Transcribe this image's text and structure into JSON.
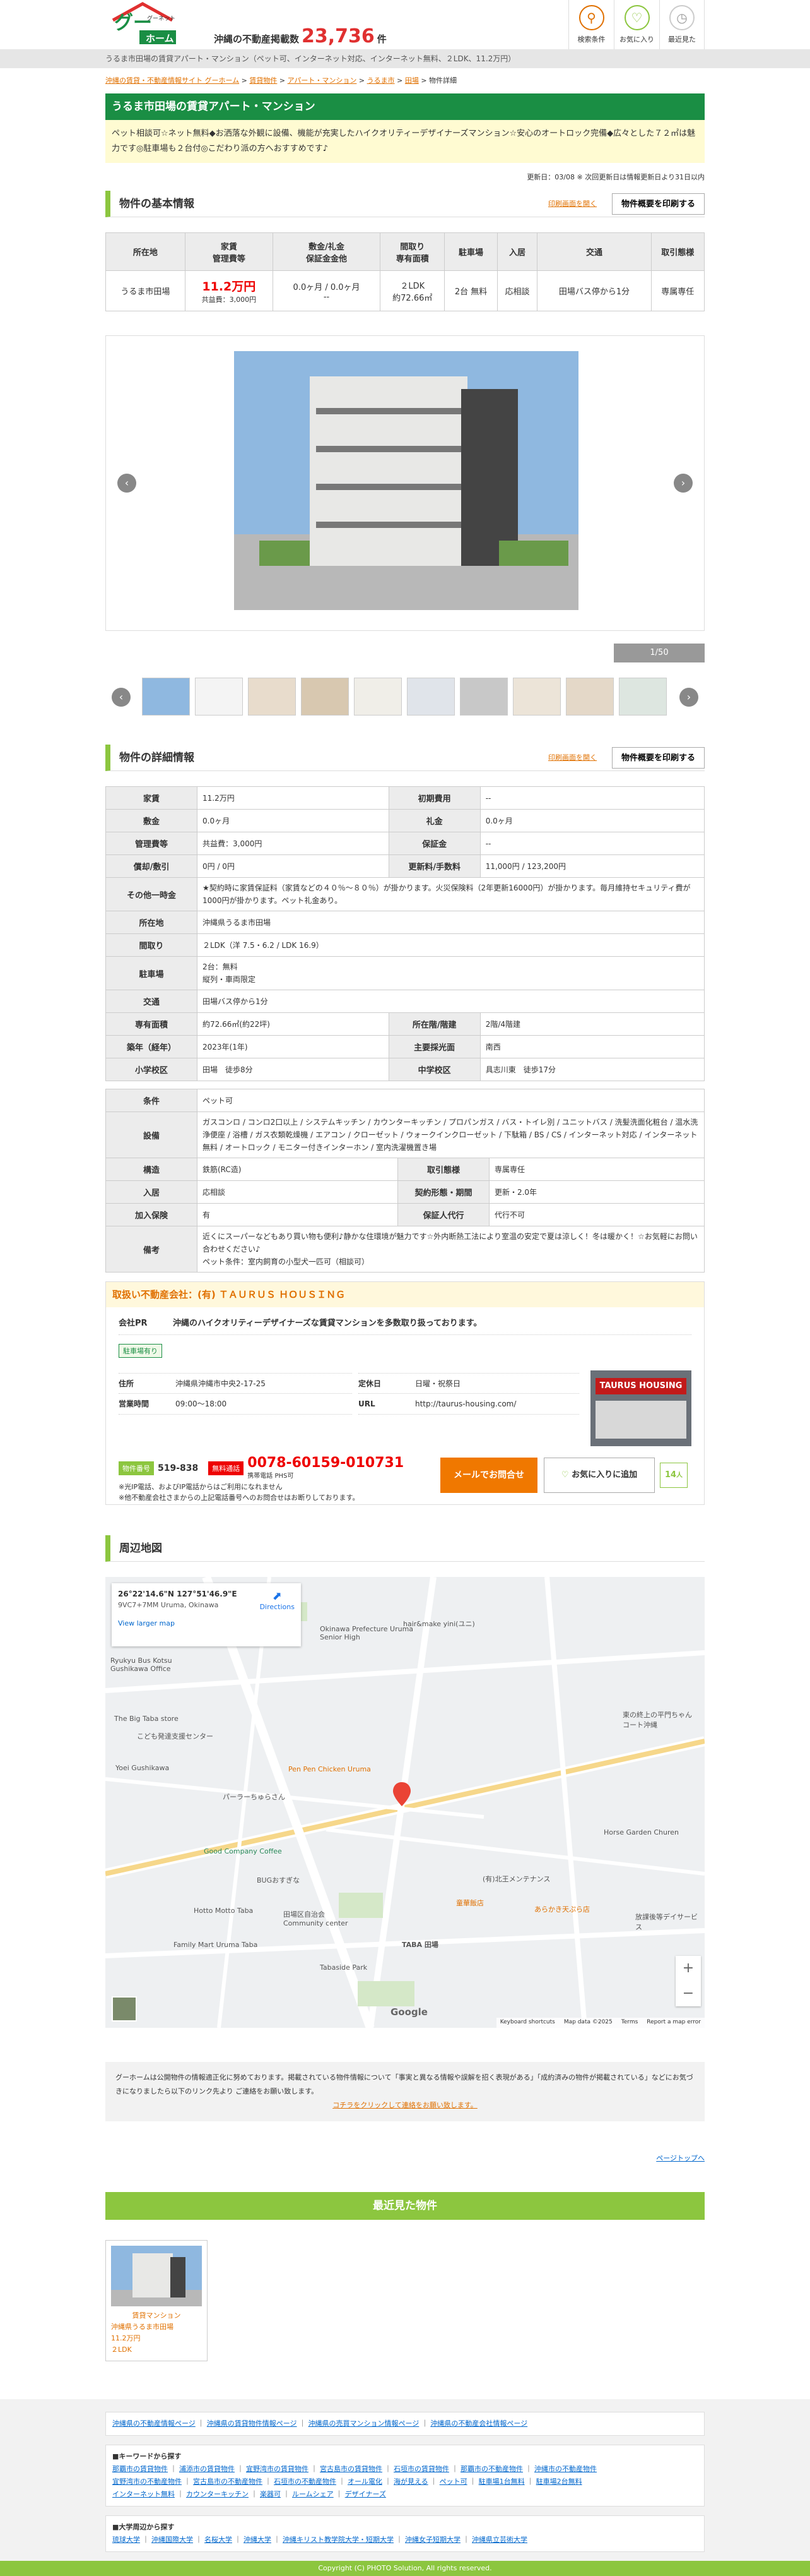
{
  "header": {
    "logo_sub": "グーネット",
    "logo_main": "ホーム",
    "count_prefix": "沖縄の不動産掲載数",
    "count_value": "23,736",
    "count_suffix": "件",
    "icons": [
      {
        "label": "検索条件",
        "icon": "search-person-icon"
      },
      {
        "label": "お気に入り",
        "icon": "heart-icon"
      },
      {
        "label": "最近見た",
        "icon": "clock-icon"
      }
    ]
  },
  "top_crumb": "うるま市田場の賃貸アパート・マンション（ペット可、インターネット対応、インターネット無料、２LDK、11.2万円）",
  "breadcrumb": [
    "沖縄の賃貸・不動産情報サイト グーホーム",
    "賃貸物件",
    "アパート・マンション",
    "うるま市",
    "田場",
    "物件詳細"
  ],
  "title": "うるま市田場の賃貸アパート・マンション",
  "catch": "ペット相談可☆ネット無料◆お洒落な外観に設備、機能が充実したハイクオリティーデザイナーズマンション☆安心のオートロック完備◆広々とした７２㎡は魅力です◎駐車場も２台付◎こだわり派の方へおすすめです♪",
  "updated": "更新日：03/08 ※ 次回更新日は情報更新日より31日以内",
  "basic": {
    "heading": "物件の基本情報",
    "print_link": "印刷画面を開く",
    "print_button": "物件概要を印刷する",
    "headers": [
      "所在地",
      "家賃\n管理費等",
      "敷金/礼金\n保証金金他",
      "間取り\n専有面積",
      "駐車場",
      "入居",
      "交通",
      "取引態様"
    ],
    "row": {
      "location": "うるま市田場",
      "rent": "11.2万円",
      "fee": "共益費：3,000円",
      "deposit": "0.0ヶ月 / 0.0ヶ月",
      "deposit2": "--",
      "layout": "２LDK",
      "area": "約72.66㎡",
      "parking": "2台 無料",
      "movein": "応相談",
      "access": "田場バス停から1分",
      "trade": "専属専任"
    }
  },
  "gallery": {
    "counter": "1/50"
  },
  "detail": {
    "heading": "物件の詳細情報",
    "print_link": "印刷画面を開く",
    "print_button": "物件概要を印刷する",
    "rows": [
      {
        "k1": "家賃",
        "v1": "11.2万円",
        "k2": "初期費用",
        "v2": "--"
      },
      {
        "k1": "敷金",
        "v1": "0.0ヶ月",
        "k2": "礼金",
        "v2": "0.0ヶ月"
      },
      {
        "k1": "管理費等",
        "v1": "共益費：3,000円",
        "k2": "保証金",
        "v2": "--"
      },
      {
        "k1": "償却/敷引",
        "v1": "0円 / 0円",
        "k2": "更新料/手数料",
        "v2": "11,000円 / 123,200円"
      }
    ],
    "other_cost_label": "その他一時金",
    "other_cost": "★契約時に家賃保証料（家賃などの４０％〜８０％）が掛かります。火災保険料（2年更新16000円）が掛かります。毎月維持セキュリティ費が1000円が掛かります。ペット礼金あり。",
    "location_label": "所在地",
    "location": "沖縄県うるま市田場",
    "layout_label": "間取り",
    "layout": "２LDK（洋 7.5・6.2 / LDK 16.9）",
    "parking_label": "駐車場",
    "parking1": "2台：無料",
    "parking2": "縦列・車両限定",
    "access_label": "交通",
    "access": "田場バス停から1分",
    "rows2": [
      {
        "k1": "専有面積",
        "v1": "約72.66㎡(約22坪)",
        "k2": "所在階/階建",
        "v2": "2階/4階建"
      },
      {
        "k1": "築年（経年）",
        "v1": "2023年(1年)",
        "k2": "主要採光面",
        "v2": "南西"
      },
      {
        "k1": "小学校区",
        "v1": "田場　徒歩8分",
        "k2": "中学校区",
        "v2": "具志川東　徒歩17分"
      }
    ],
    "cond_label": "条件",
    "cond": "ペット可",
    "equip_label": "設備",
    "equip": "ガスコンロ / コンロ2口以上 / システムキッチン / カウンターキッチン / プロパンガス / バス・トイレ別 / ユニットバス / 洗髪洗面化粧台 / 温水洗浄便座 / 浴槽 / ガス衣類乾燥機 / エアコン / クローゼット / ウォークインクローゼット / 下駄箱 / BS / CS / インターネット対応 / インターネット無料 / オートロック / モニター付きインターホン / 室内洗濯機置き場",
    "rows3": [
      {
        "k1": "構造",
        "v1": "鉄筋(RC造)",
        "k2": "取引態様",
        "v2": "専属専任"
      },
      {
        "k1": "入居",
        "v1": "応相談",
        "k2": "契約形態・期間",
        "v2": "更新・2.0年"
      },
      {
        "k1": "加入保険",
        "v1": "有",
        "k2": "保証人代行",
        "v2": "代行不可"
      }
    ],
    "remark_label": "備考",
    "remark1": "近くにスーパーなどもあり買い物も便利♪静かな住環境が魅力です☆外内断熱工法により室温の安定で夏は涼しく！冬は暖かく！☆お気軽にお問い合わせください♪",
    "remark2": "ペット条件：室内飼育の小型犬一匹可（相談可）"
  },
  "company": {
    "heading": "取扱い不動産会社：(有) ＴＡＵＲＵＳ ＨＯＵＳＩＮＧ",
    "pr_label": "会社PR",
    "pr": "沖縄のハイクオリティーデザイナーズな賃貸マンションを多数取り扱っております。",
    "tag": "駐車場有り",
    "addr_label": "住所",
    "addr": "沖縄県沖縄市中央2-17-25",
    "hours_label": "営業時間",
    "hours": "09:00〜18:00",
    "holiday_label": "定休日",
    "holiday": "日曜・祝祭日",
    "url_label": "URL",
    "url": "http://taurus-housing.com/",
    "sign": "TAURUS HOUSING",
    "id_label": "物件番号",
    "id": "519-838",
    "free_label": "無料通話",
    "tel": "0078-60159-010731",
    "tel_note": "携帯電話 PHS可",
    "note1": "※光IP電話、およびIP電話からはご利用になれません",
    "note2": "※他不動産会社さまからの上記電話番号へのお問合せはお断りしております。",
    "mail_btn": "メールでお問合せ",
    "fav_btn": "お気に入りに追加",
    "fav_count": "14",
    "fav_unit": "人"
  },
  "map": {
    "heading": "周辺地図",
    "coords": "26°22'14.6\"N 127°51'46.9\"E",
    "plus": "9VC7+7MM Uruma, Okinawa",
    "larger": "View larger map",
    "directions": "Directions",
    "labels": [
      {
        "t": "Ryukyu Bus Kotsu Gushikawa Office"
      },
      {
        "t": "The Big Taba store"
      },
      {
        "t": "こども発達支援センター"
      },
      {
        "t": "Yoei Gushikawa"
      },
      {
        "t": "Pen Pen Chicken Uruma"
      },
      {
        "t": "パーラーちゅらさん"
      },
      {
        "t": "Good Company Coffee"
      },
      {
        "t": "BUGおすぎな"
      },
      {
        "t": "Hotto Motto Taba"
      },
      {
        "t": "Family Mart Uruma Taba"
      },
      {
        "t": "田場区自治会 Community center"
      },
      {
        "t": "Tabaside Park"
      },
      {
        "t": "TABA 田場"
      },
      {
        "t": "Horse Garden Churen"
      },
      {
        "t": "(有)北王メンテナンス"
      },
      {
        "t": "Okinawa Prefecture Uruma Senior High"
      },
      {
        "t": "hair&make yini(ユニ)"
      },
      {
        "t": "東の終上の平門ちゃんコート沖縄"
      },
      {
        "t": "放課後等デイサービス"
      },
      {
        "t": "あらかき天ぷら店"
      },
      {
        "t": "童華飯店"
      }
    ],
    "footer": [
      "Keyboard shortcuts",
      "Map data ©2025",
      "Terms",
      "Report a map error"
    ],
    "google": "Google"
  },
  "notice": {
    "text": "グーホームは公開物件の情報適正化に努めております。掲載されている物件情報について「事実と異なる情報や誤解を招く表現がある」「成約済みの物件が掲載されている」などにお気づきになりましたら以下のリンク先より ご連絡をお願い致します。",
    "link": "コチラをクリックして連絡をお願い致します。"
  },
  "pagetop": "ページトップへ",
  "recent": {
    "heading": "最近見た物件",
    "items": [
      {
        "type": "賃貸マンション",
        "name": "沖縄県うるま市田場",
        "price": "11.2万円",
        "layout": "２LDK"
      }
    ]
  },
  "footer": {
    "links1": [
      "沖縄県の不動産情報ページ",
      "沖縄県の賃貸物件情報ページ",
      "沖縄県の売買マンション情報ページ",
      "沖縄県の不動産会社情報ページ"
    ],
    "kw_label": "■キーワードから探す",
    "kw": [
      "那覇市の賃貸物件",
      "浦添市の賃貸物件",
      "宜野湾市の賃貸物件",
      "宮古島市の賃貸物件",
      "石垣市の賃貸物件",
      "那覇市の不動産物件",
      "沖縄市の不動産物件",
      "宜野湾市の不動産物件",
      "宮古島市の不動産物件",
      "石垣市の不動産物件",
      "オール電化",
      "海が見える",
      "ペット可",
      "駐車場1台無料",
      "駐車場2台無料",
      "インターネット無料",
      "カウンターキッチン",
      "楽器可",
      "ルームシェア",
      "デザイナーズ"
    ],
    "uni_label": "■大学周辺から探す",
    "uni": [
      "琉球大学",
      "沖縄国際大学",
      "名桜大学",
      "沖縄大学",
      "沖縄キリスト教学院大学・短期大学",
      "沖縄女子短期大学",
      "沖縄県立芸術大学"
    ],
    "copyright": "Copyright (C) PHOTO Solution, All rights reserved."
  }
}
